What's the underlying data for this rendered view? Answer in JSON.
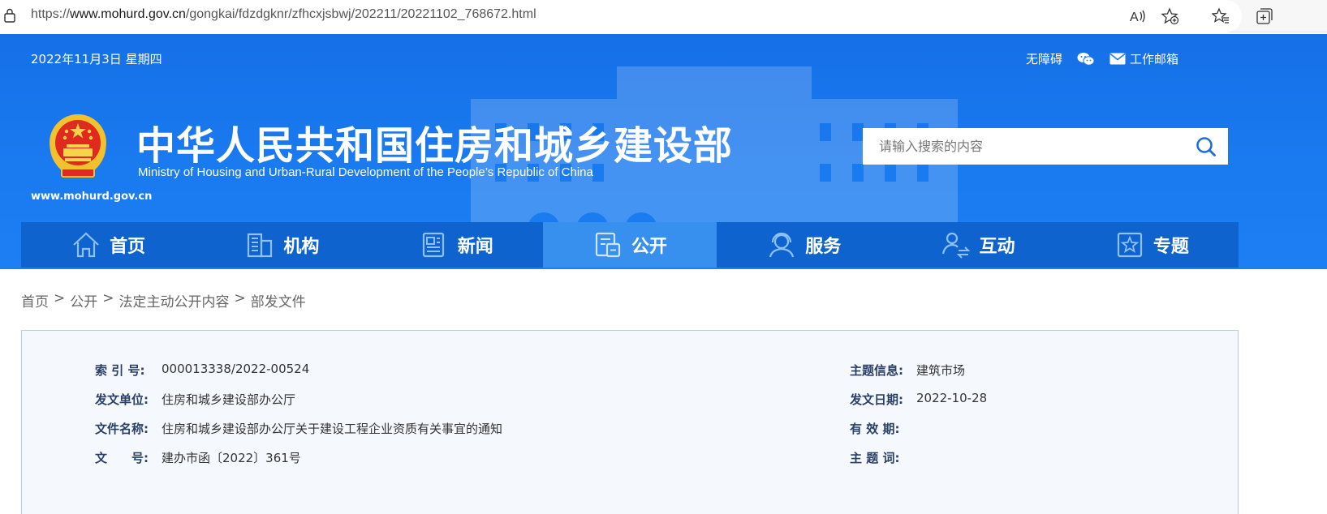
{
  "browser": {
    "url_prefix": "https://",
    "url_domain": "www.mohurd.gov.cn",
    "url_path": "/gongkai/fdzdgknr/zfhcxjsbwj/202211/20221102_768672.html",
    "icons": [
      "lock-icon",
      "read-aloud-icon",
      "add-favorite-icon",
      "favorites-icon",
      "collections-icon"
    ]
  },
  "header": {
    "date": "2022年11月3日 星期四",
    "accessibility": "无障碍",
    "email": "工作邮箱",
    "title_cn": "中华人民共和国住房和城乡建设部",
    "title_en": "Ministry of Housing and Urban-Rural Development of the People’s Republic of China",
    "site_url": "www.mohurd.gov.cn",
    "search_placeholder": "请输入搜索的内容"
  },
  "nav": {
    "items": [
      {
        "label": "首页",
        "icon": "home-icon"
      },
      {
        "label": "机构",
        "icon": "building-icon"
      },
      {
        "label": "新闻",
        "icon": "newspaper-icon"
      },
      {
        "label": "公开",
        "icon": "public-docs-icon",
        "active": true
      },
      {
        "label": "服务",
        "icon": "service-icon"
      },
      {
        "label": "互动",
        "icon": "interaction-icon"
      },
      {
        "label": "专题",
        "icon": "star-topic-icon"
      }
    ]
  },
  "breadcrumb": {
    "items": [
      "首页",
      "公开",
      "法定主动公开内容",
      "部发文件"
    ],
    "separator": ">"
  },
  "info": {
    "index_label": "索 引 号:",
    "index_value": "000013338/2022-00524",
    "issuer_label": "发文单位:",
    "issuer_value": "住房和城乡建设部办公厅",
    "docname_label": "文件名称:",
    "docname_value": "住房和城乡建设部办公厅关于建设工程企业资质有关事宜的通知",
    "docno_label": "文　　号:",
    "docno_value": "建办市函〔2022〕361号",
    "topic_label": "主题信息:",
    "topic_value": "建筑市场",
    "date_label": "发文日期:",
    "date_value": "2022-10-28",
    "validity_label": "有 效 期:",
    "validity_value": "",
    "keywords_label": "主 题 词:",
    "keywords_value": ""
  },
  "colors": {
    "header_blue": "#1a7af0",
    "nav_blue": "#0e63cf",
    "nav_active": "#3790ee",
    "info_bg": "#f5f9fe",
    "info_border": "#b5cbe8"
  }
}
